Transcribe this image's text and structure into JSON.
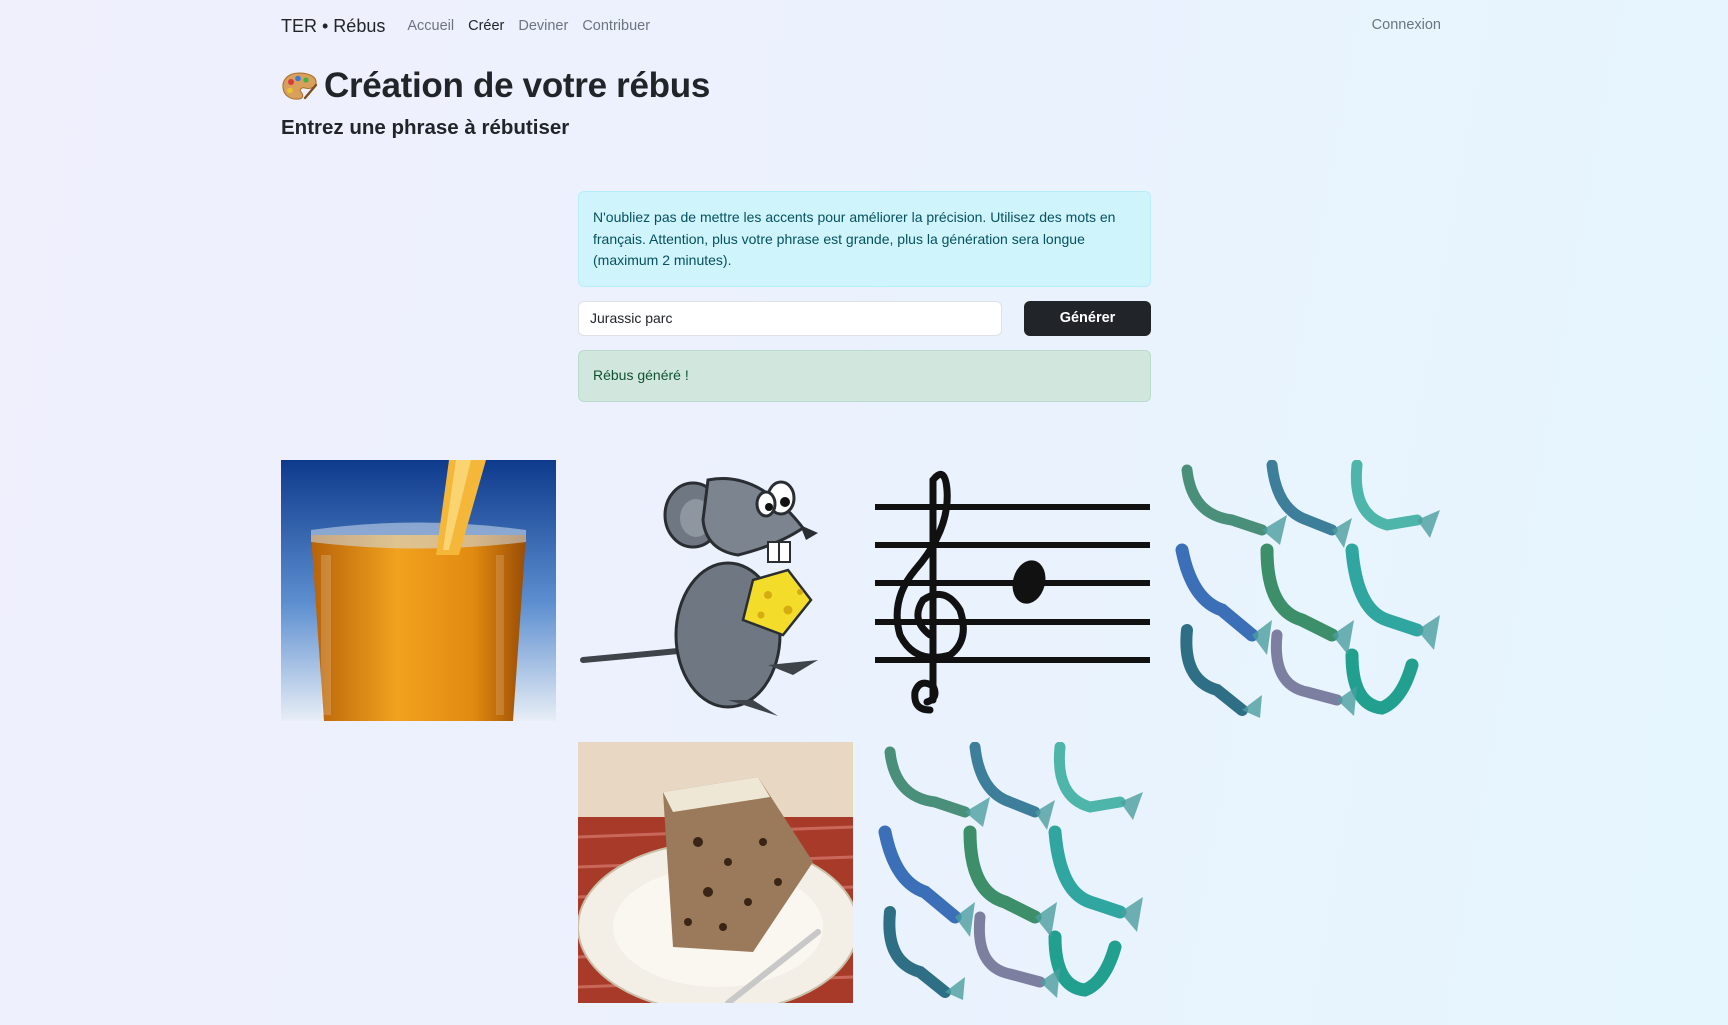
{
  "nav": {
    "brand": "TER • Rébus",
    "links": [
      "Accueil",
      "Créer",
      "Deviner",
      "Contribuer"
    ],
    "active": "Créer",
    "login": "Connexion"
  },
  "page": {
    "title": "Création de votre rébus",
    "subtitle": "Entrez une phrase à rébutiser"
  },
  "form": {
    "info": "N'oubliez pas de mettre les accents pour améliorer la précision. Utilisez des mots en français. Attention, plus votre phrase est grande, plus la génération sera longue (maximum 2 minutes).",
    "input_value": "Jurassic parc",
    "button": "Générer",
    "success": "Rébus généré !"
  },
  "images": [
    {
      "subject": "glass of orange juice"
    },
    {
      "subject": "cartoon rat holding cheese"
    },
    {
      "subject": "treble clef with note on staff"
    },
    {
      "subject": "mermaid tails"
    },
    {
      "subject": "slice of fruit cake on plate"
    },
    {
      "subject": "mermaid tails"
    }
  ]
}
